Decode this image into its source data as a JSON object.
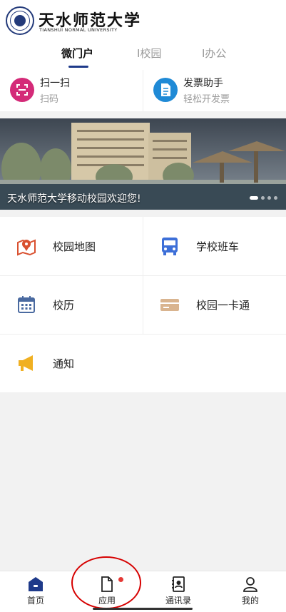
{
  "header": {
    "logo_cn": "天水师范大学",
    "logo_en": "TIANSHUI NORMAL UNIVERSITY"
  },
  "tabs": [
    {
      "label": "微门户",
      "active": true
    },
    {
      "label": "I校园",
      "active": false
    },
    {
      "label": "I办公",
      "active": false
    }
  ],
  "quick_actions": [
    {
      "title": "扫一扫",
      "subtitle": "扫码",
      "icon": "scan-icon",
      "color": "#d42a78"
    },
    {
      "title": "发票助手",
      "subtitle": "轻松开发票",
      "icon": "invoice-icon",
      "color": "#1f8ad6"
    }
  ],
  "banner": {
    "caption": "天水师范大学移动校园欢迎您!",
    "image": "campus-photo",
    "slide_count": 4,
    "active_slide": 1
  },
  "apps": [
    {
      "label": "校园地图",
      "icon": "map-pin-icon",
      "color": "#d9502f"
    },
    {
      "label": "学校班车",
      "icon": "bus-icon",
      "color": "#3d6fd8"
    },
    {
      "label": "校历",
      "icon": "calendar-icon",
      "color": "#4a6aa0"
    },
    {
      "label": "校园一卡通",
      "icon": "card-icon",
      "color": "#d9b48f"
    },
    {
      "label": "通知",
      "icon": "megaphone-icon",
      "color": "#f0b022"
    }
  ],
  "tabbar": [
    {
      "label": "首页",
      "icon": "home-icon"
    },
    {
      "label": "应用",
      "icon": "document-icon",
      "badge": true
    },
    {
      "label": "通讯录",
      "icon": "contacts-icon"
    },
    {
      "label": "我的",
      "icon": "user-icon"
    }
  ],
  "colors": {
    "primary": "#1e3a8a",
    "badge": "#e53935",
    "annotation": "#d60000"
  }
}
